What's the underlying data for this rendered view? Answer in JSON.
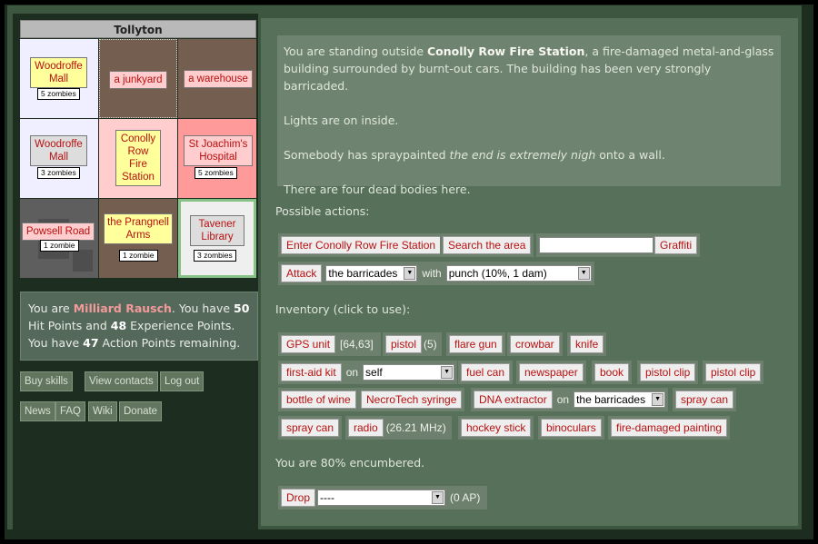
{
  "map": {
    "title": "Tollyton",
    "cells": [
      {
        "label": "Woodroffe Mall",
        "zombies": "5 zombies"
      },
      {
        "label": "a junkyard",
        "zombies": ""
      },
      {
        "label": "a warehouse",
        "zombies": ""
      },
      {
        "label": "Woodroffe Mall",
        "zombies": "3 zombies"
      },
      {
        "label": "Conolly Row Fire Station",
        "zombies": ""
      },
      {
        "label": "St Joachim's Hospital",
        "zombies": "5 zombies"
      },
      {
        "label": "Powsell Road",
        "zombies": "1 zombie"
      },
      {
        "label": "the Prangnell Arms",
        "zombies": "1 zombie"
      },
      {
        "label": "Tavener Library",
        "zombies": "3 zombies"
      }
    ]
  },
  "player": {
    "line1_pre": "You are ",
    "name": "Milliard Rausch",
    "line1_mid": ". You have ",
    "hp": "50",
    "hp_label": "Hit Points and ",
    "xp": "48",
    "xp_label": " Experience Points.",
    "ap_pre": "You have ",
    "ap": "47",
    "ap_label": " Action Points remaining."
  },
  "left_buttons": {
    "buy_skills": "Buy skills",
    "view_contacts": "View contacts",
    "log_out": "Log out",
    "news": "News",
    "faq": "FAQ",
    "wiki": "Wiki",
    "donate": "Donate"
  },
  "description": {
    "p1_pre": "You are standing outside ",
    "p1_place": "Conolly Row Fire Station",
    "p1_post": ", a fire-damaged metal-and-glass building surrounded by burnt-out cars. The building has been very strongly barricaded.",
    "p2": "Lights are on inside.",
    "p3_pre": "Somebody has spraypainted ",
    "p3_graffiti": "the end is extremely nigh",
    "p3_post": " onto a wall.",
    "p4": "There are four dead bodies here."
  },
  "actions": {
    "heading": "Possible actions:",
    "enter": "Enter Conolly Row Fire Station",
    "search": "Search the area",
    "graffiti_value": "",
    "graffiti": "Graffiti",
    "attack": "Attack",
    "attack_target": "the barricades",
    "with": "with",
    "weapon": "punch (10%, 1 dam)"
  },
  "inventory": {
    "heading": "Inventory (click to use):",
    "gps": "GPS unit",
    "gps_coords": "[64,63]",
    "pistol": "pistol",
    "pistol_ammo": "(5)",
    "flare_gun": "flare gun",
    "crowbar": "crowbar",
    "knife": "knife",
    "first_aid": "first-aid kit",
    "on1": "on",
    "first_aid_target": "self",
    "fuel_can": "fuel can",
    "newspaper": "newspaper",
    "book": "book",
    "pistol_clip1": "pistol clip",
    "pistol_clip2": "pistol clip",
    "bottle_wine": "bottle of wine",
    "necrotech": "NecroTech syringe",
    "dna": "DNA extractor",
    "on2": "on",
    "dna_target": "the barricades",
    "spray_can1": "spray can",
    "spray_can2": "spray can",
    "radio": "radio",
    "radio_freq": "(26.21 MHz)",
    "hockey": "hockey stick",
    "binoculars": "binoculars",
    "painting": "fire-damaged painting"
  },
  "encumbrance": "You are 80% encumbered.",
  "drop": {
    "label": "Drop",
    "selected": "----",
    "cost": "(0 AP)"
  },
  "colors": {
    "button_text": "#b81010",
    "cell_yellow": "#ffff9c",
    "cell_pink": "#ffcdcd",
    "cell_brown": "#735e50",
    "hospital_red": "#ff9a9a"
  }
}
